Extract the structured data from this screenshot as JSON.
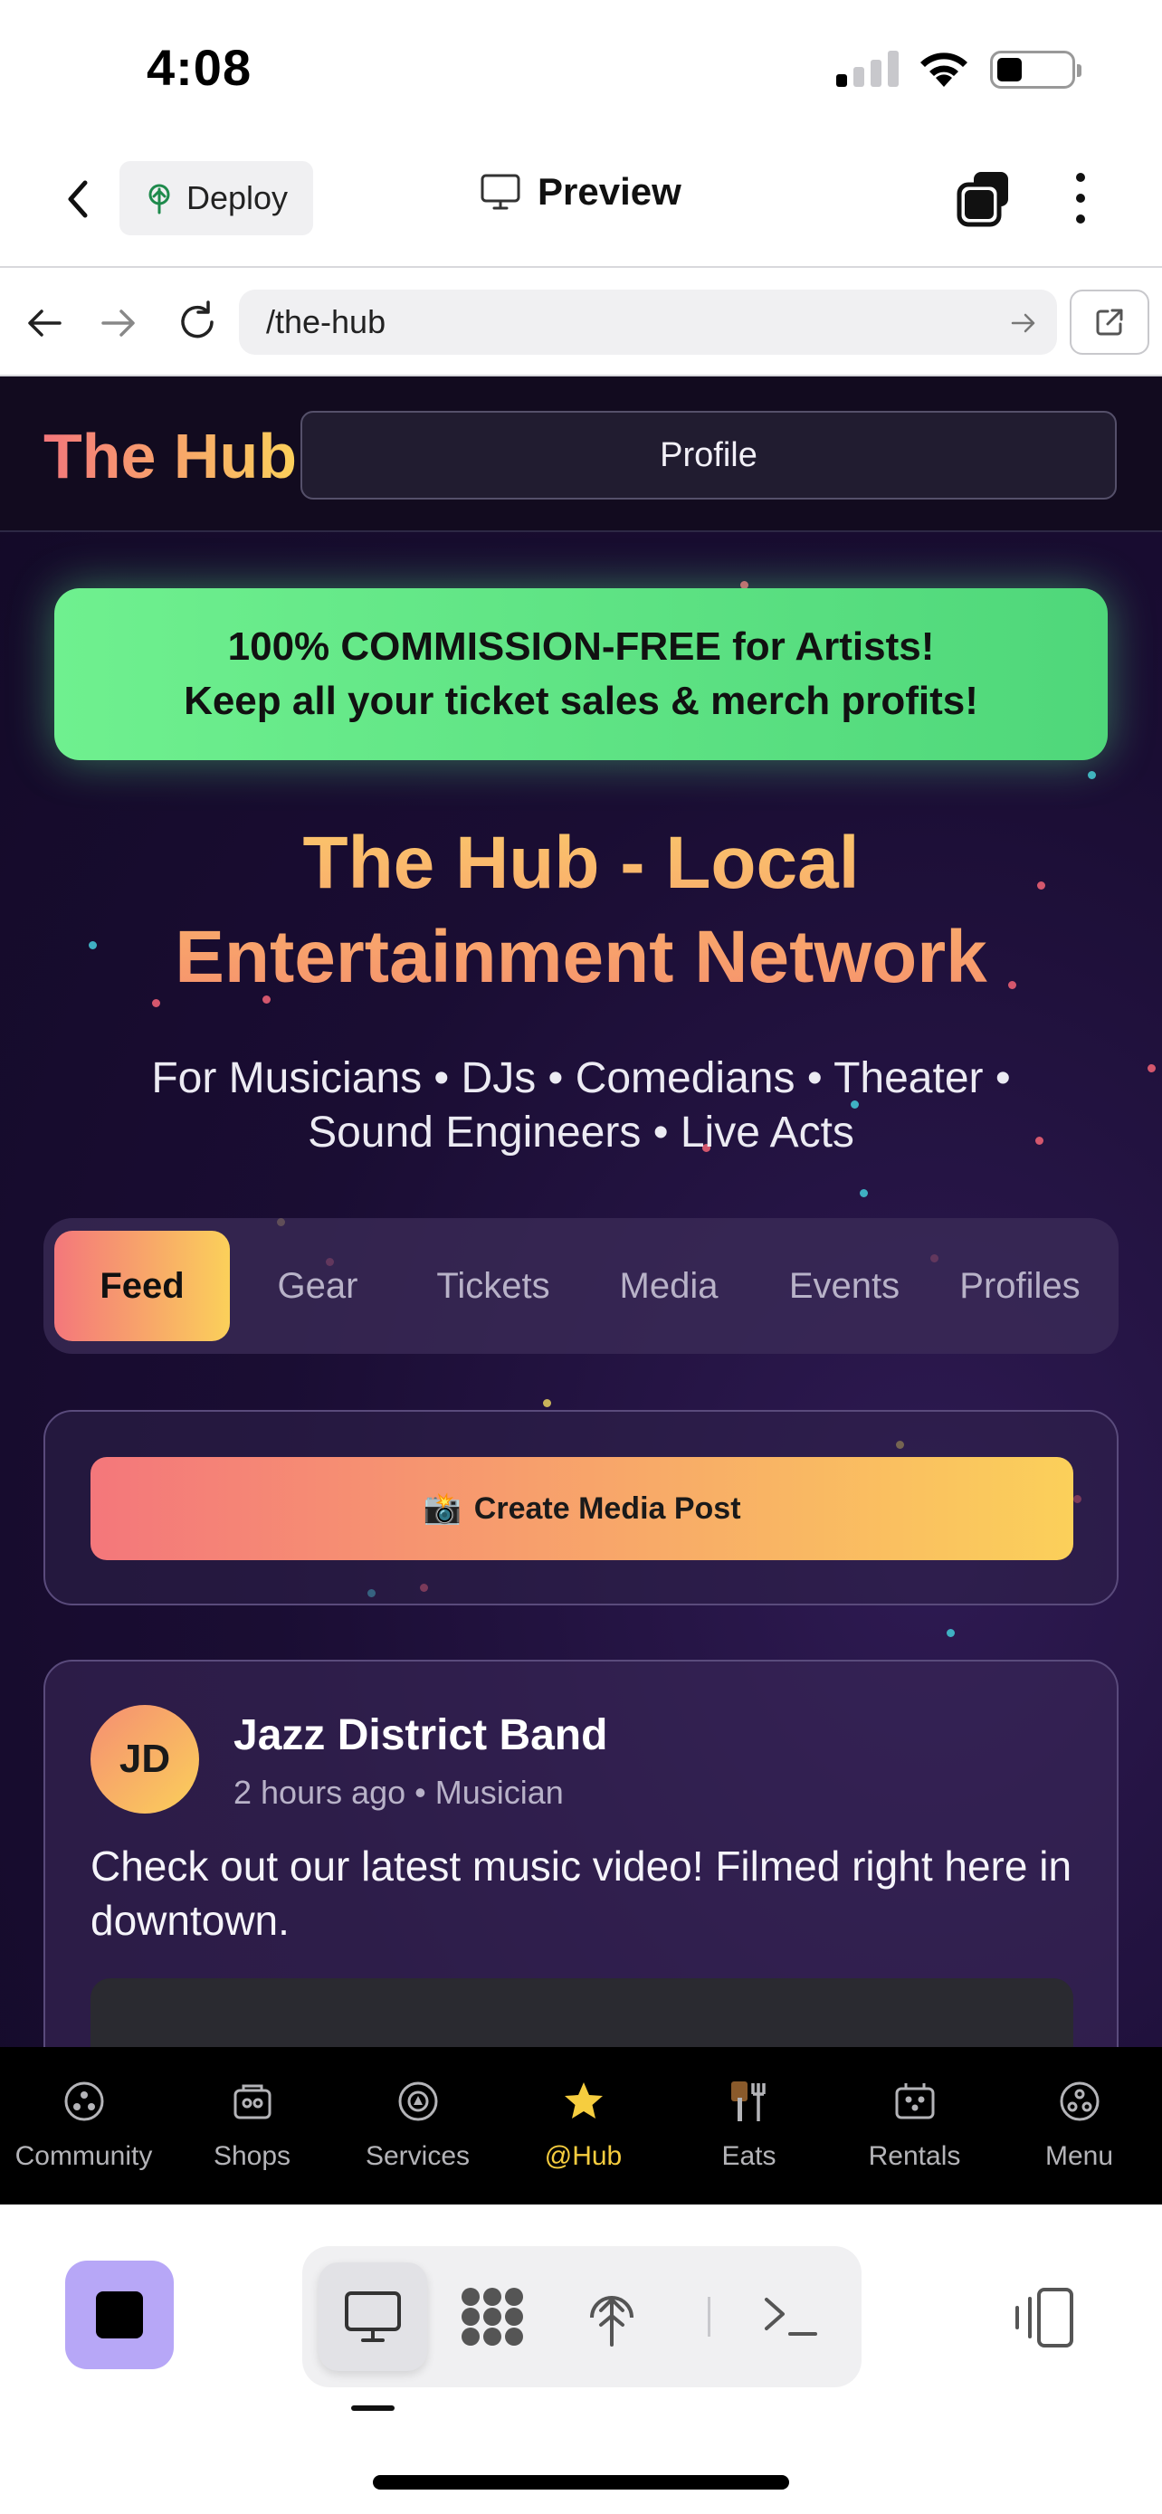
{
  "status_bar": {
    "time": "4:08",
    "battery_level": 0.35
  },
  "top_nav": {
    "deploy_label": "Deploy",
    "preview_label": "Preview",
    "icons": [
      "chevron-left-icon",
      "deploy-icon",
      "monitor-icon",
      "windows-icon",
      "more-vertical-icon"
    ]
  },
  "browser": {
    "url": "/the-hub",
    "icons": [
      "arrow-left-icon",
      "arrow-right-icon",
      "reload-icon",
      "go-arrow-icon",
      "open-external-icon"
    ]
  },
  "site": {
    "logo": "The Hub",
    "profile_label": "Profile",
    "promo": {
      "line1": "100% COMMISSION-FREE for Artists!",
      "line2": "Keep all your ticket sales & merch profits!"
    },
    "title_line1": "The Hub - Local",
    "title_line2": "Entertainment Network",
    "subtitle_line1": "For Musicians • DJs • Comedians • Theater •",
    "subtitle_line2": "Sound Engineers • Live Acts",
    "tabs": [
      {
        "label": "Feed",
        "active": true
      },
      {
        "label": "Gear",
        "active": false
      },
      {
        "label": "Tickets",
        "active": false
      },
      {
        "label": "Media",
        "active": false
      },
      {
        "label": "Events",
        "active": false
      },
      {
        "label": "Profiles",
        "active": false
      }
    ],
    "create_post": {
      "emoji": "📸",
      "label": "Create Media Post"
    },
    "post": {
      "avatar_initials": "JD",
      "author": "Jazz District Band",
      "meta": "2 hours ago • Musician",
      "text": "Check out our latest music video! Filmed right here in downtown."
    },
    "colors": {
      "accent_gradient_start": "#f4777b",
      "accent_gradient_end": "#fbd05a",
      "promo_green": "#6ff08f",
      "background": "#1a0d33"
    }
  },
  "app_tabbar": {
    "items": [
      {
        "label": "Community",
        "icon": "community-icon",
        "active": false
      },
      {
        "label": "Shops",
        "icon": "shop-icon",
        "active": false
      },
      {
        "label": "Services",
        "icon": "services-icon",
        "active": false
      },
      {
        "label": "@Hub",
        "icon": "star-icon",
        "active": true
      },
      {
        "label": "Eats",
        "icon": "utensils-icon",
        "active": false
      },
      {
        "label": "Rentals",
        "icon": "rentals-icon",
        "active": false
      },
      {
        "label": "Menu",
        "icon": "menu-icon",
        "active": false
      }
    ],
    "active_color": "#f6cd3f"
  },
  "dev_toolbar": {
    "icons": [
      "stop-icon",
      "monitor-icon",
      "apps-grid-icon",
      "deploy-icon",
      "terminal-icon",
      "devices-icon"
    ],
    "active_mode": "monitor"
  }
}
